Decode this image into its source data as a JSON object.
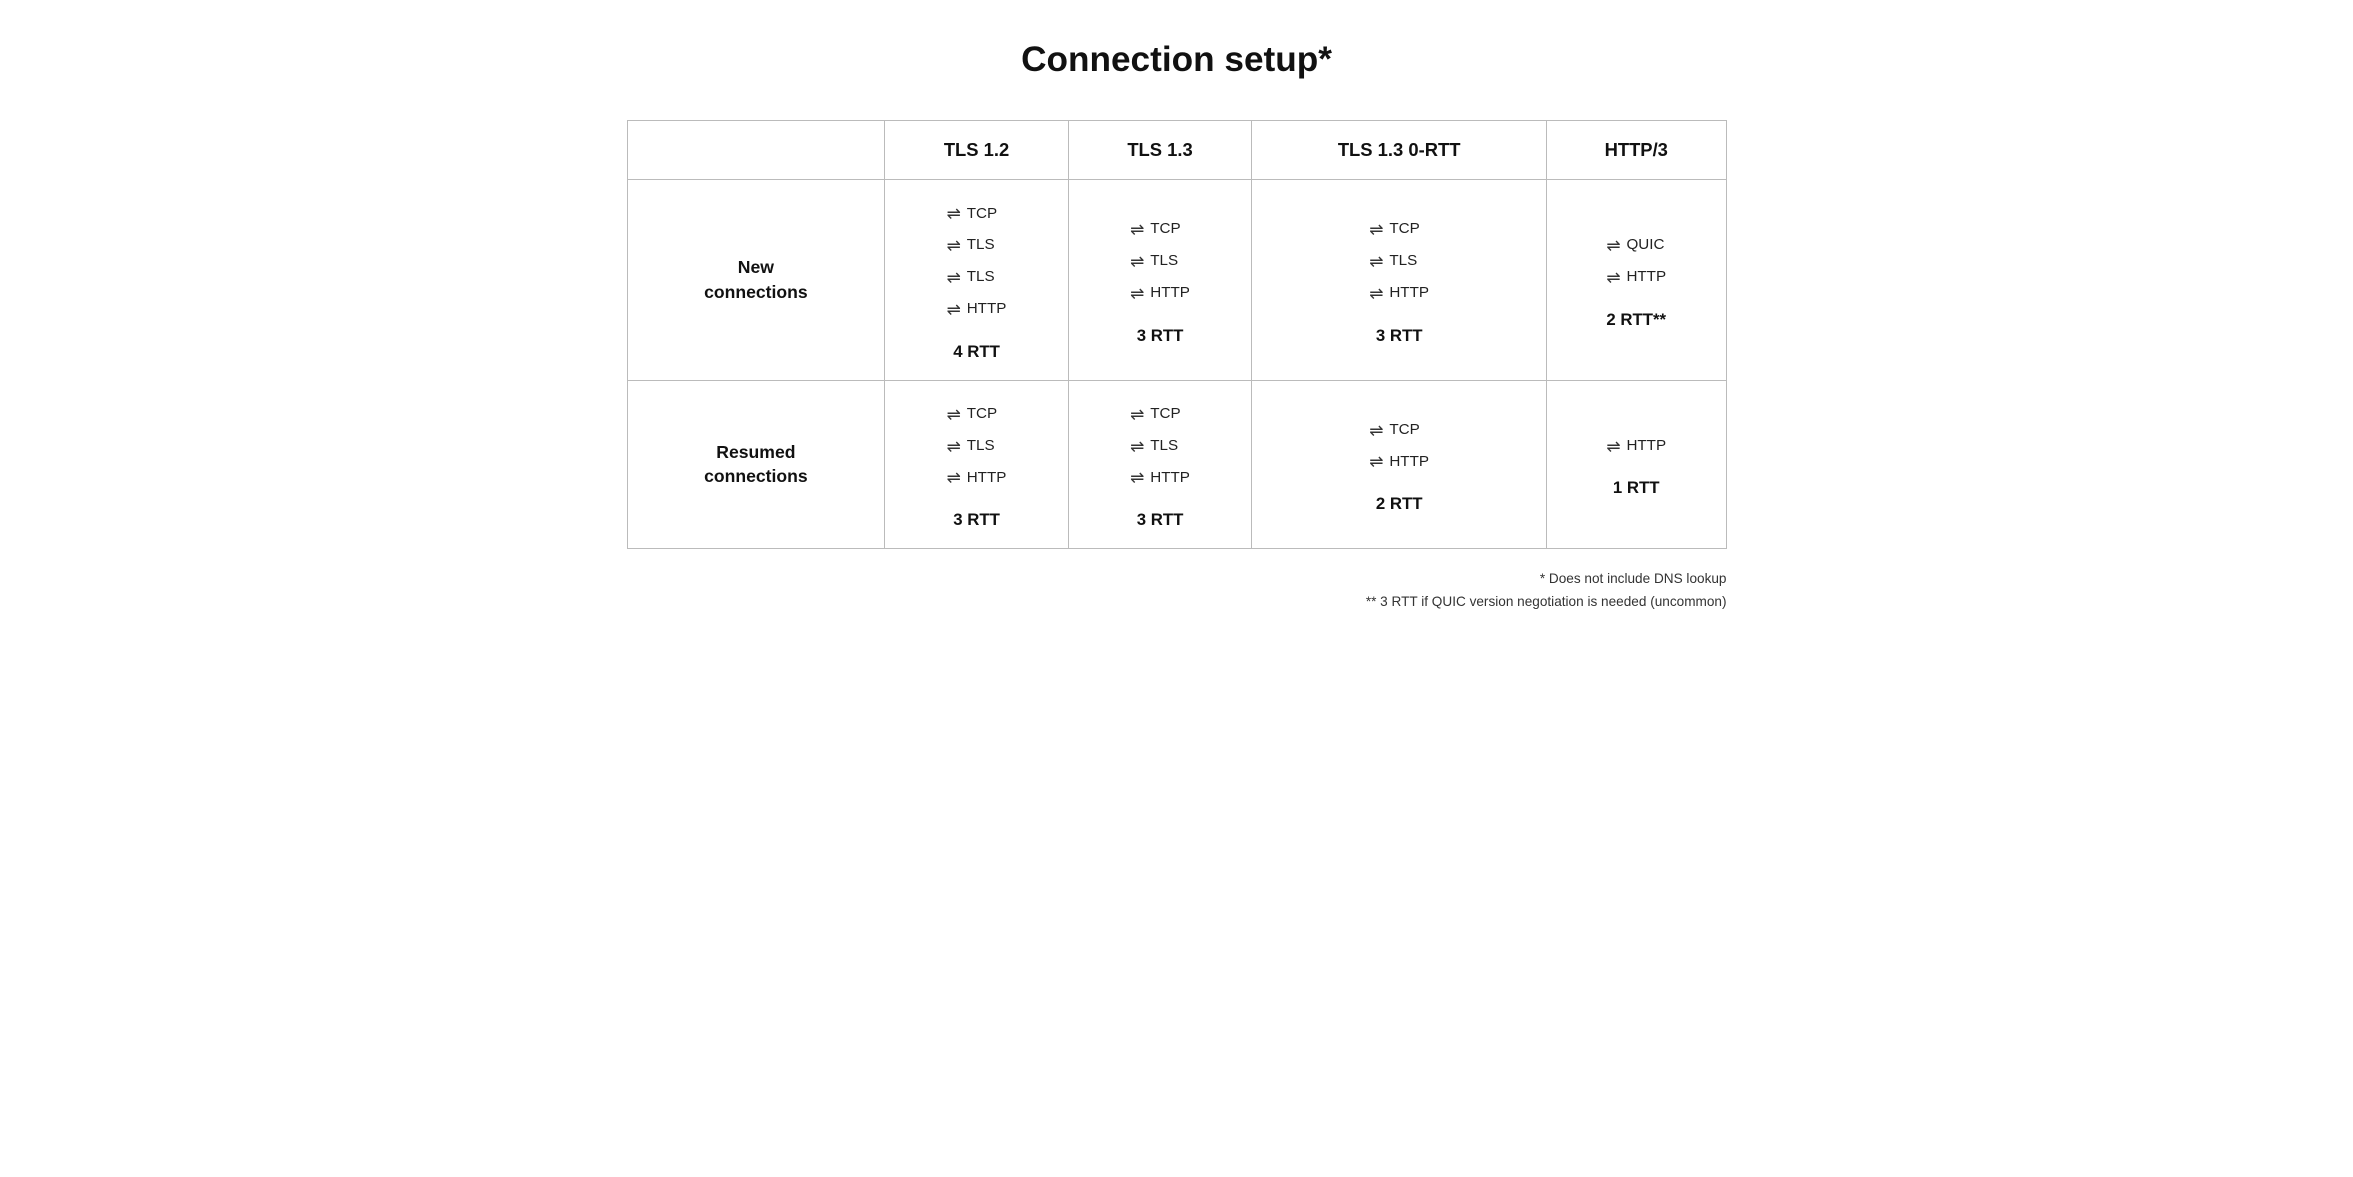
{
  "title": "Connection setup*",
  "columns": [
    "",
    "TLS 1.2",
    "TLS 1.3",
    "TLS 1.3 0-RTT",
    "HTTP/3"
  ],
  "rows": [
    {
      "label": "New\nconnections",
      "cells": [
        {
          "steps": [
            "TCP",
            "TLS",
            "TLS",
            "HTTP"
          ],
          "rtt": "4 RTT"
        },
        {
          "steps": [
            "TCP",
            "TLS",
            "HTTP"
          ],
          "rtt": "3 RTT"
        },
        {
          "steps": [
            "TCP",
            "TLS",
            "HTTP"
          ],
          "rtt": "3 RTT"
        },
        {
          "steps": [
            "QUIC",
            "HTTP"
          ],
          "rtt": "2 RTT**"
        }
      ]
    },
    {
      "label": "Resumed\nconnections",
      "cells": [
        {
          "steps": [
            "TCP",
            "TLS",
            "HTTP"
          ],
          "rtt": "3 RTT"
        },
        {
          "steps": [
            "TCP",
            "TLS",
            "HTTP"
          ],
          "rtt": "3 RTT"
        },
        {
          "steps": [
            "TCP",
            "HTTP"
          ],
          "rtt": "2 RTT"
        },
        {
          "steps": [
            "HTTP"
          ],
          "rtt": "1 RTT"
        }
      ]
    }
  ],
  "footnotes": [
    "* Does not include DNS lookup",
    "** 3 RTT if QUIC version negotiation is needed (uncommon)"
  ]
}
